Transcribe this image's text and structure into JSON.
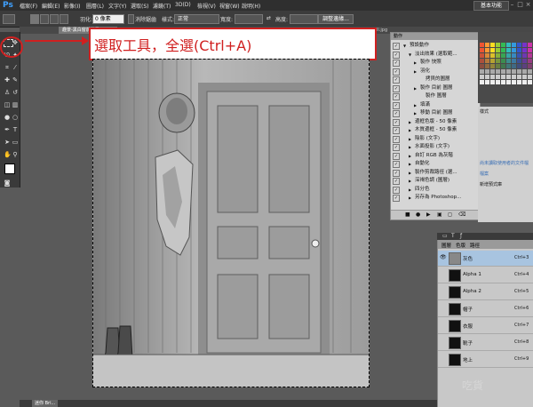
{
  "app": {
    "logo": "Ps"
  },
  "menubar": {
    "items": [
      "檔案(F)",
      "編輯(E)",
      "影像(I)",
      "圖層(L)",
      "文字(Y)",
      "選取(S)",
      "濾鏡(T)",
      "3D(D)",
      "檢視(V)",
      "視窗(W)",
      "說明(H)"
    ],
    "workspace_button": "基本功能"
  },
  "options": {
    "feather_label": "羽化:",
    "feather_value": "0 像素",
    "antialias_label": "消除鋸齒",
    "style_label": "樣式:",
    "style_value": "正常",
    "width_label": "寬度:",
    "height_label": "高度:",
    "refine_button": "調整邊緣..."
  },
  "tabs": {
    "doc": "趣景-黑白窗前外景.PSD...",
    "doc2": "ster_fall.jpg"
  },
  "callout": {
    "text": "選取工具，全選(Ctrl+A)"
  },
  "actions_panel": {
    "title": "動作",
    "rows": [
      {
        "label": "預設動作",
        "indent": 0,
        "arrow": "▼",
        "folder": true
      },
      {
        "label": "淡出效果 (選取範...",
        "indent": 1,
        "arrow": "▼"
      },
      {
        "label": "製作 快照",
        "indent": 2,
        "arrow": "▶"
      },
      {
        "label": "羽化",
        "indent": 2,
        "arrow": "▶"
      },
      {
        "label": "拷貝的圖層",
        "indent": 3,
        "arrow": ""
      },
      {
        "label": "製作 目前 圖層",
        "indent": 2,
        "arrow": "▶"
      },
      {
        "label": "製作 圖層",
        "indent": 3,
        "arrow": ""
      },
      {
        "label": "填滿",
        "indent": 2,
        "arrow": "▶"
      },
      {
        "label": "移動 目前 圖層",
        "indent": 2,
        "arrow": "▶"
      },
      {
        "label": "邊框色版 - 50 像素",
        "indent": 1,
        "arrow": "▶"
      },
      {
        "label": "木質邊框 - 50 像素",
        "indent": 1,
        "arrow": "▶"
      },
      {
        "label": "陰影 (文字)",
        "indent": 1,
        "arrow": "▶"
      },
      {
        "label": "水面投影 (文字)",
        "indent": 1,
        "arrow": "▶"
      },
      {
        "label": "自訂 RGB 為灰階",
        "indent": 1,
        "arrow": "▶"
      },
      {
        "label": "自動化",
        "indent": 1,
        "arrow": "▶"
      },
      {
        "label": "製作剪裁路徑 (選...",
        "indent": 1,
        "arrow": "▶"
      },
      {
        "label": "深褐色調 (圖層)",
        "indent": 1,
        "arrow": "▶"
      },
      {
        "label": "四分色",
        "indent": 1,
        "arrow": "▶"
      },
      {
        "label": "另存為 Photoshop...",
        "indent": 1,
        "arrow": "▶"
      }
    ]
  },
  "mid_panel": {
    "tab": "樣式",
    "lines": [
      "尚未讀取使用者的文件檔",
      "檔案",
      "新增預式庫"
    ]
  },
  "layers_panel": {
    "tabs": [
      "圖層",
      "色版",
      "路徑"
    ],
    "rows": [
      {
        "name": "灰色",
        "shortcut": "Ctrl+3",
        "selected": true,
        "eye": true
      },
      {
        "name": "Alpha 1",
        "shortcut": "Ctrl+4",
        "selected": false,
        "eye": false
      },
      {
        "name": "Alpha 2",
        "shortcut": "Ctrl+5",
        "selected": false,
        "eye": false
      },
      {
        "name": "帽子",
        "shortcut": "Ctrl+6",
        "selected": false,
        "eye": false
      },
      {
        "name": "衣服",
        "shortcut": "Ctrl+7",
        "selected": false,
        "eye": false
      },
      {
        "name": "靴子",
        "shortcut": "Ctrl+8",
        "selected": false,
        "eye": false
      },
      {
        "name": "地上",
        "shortcut": "Ctrl+9",
        "selected": false,
        "eye": false
      }
    ]
  },
  "bottom": {
    "tab": "迷你 Bri..."
  },
  "watermark": "吃貨"
}
